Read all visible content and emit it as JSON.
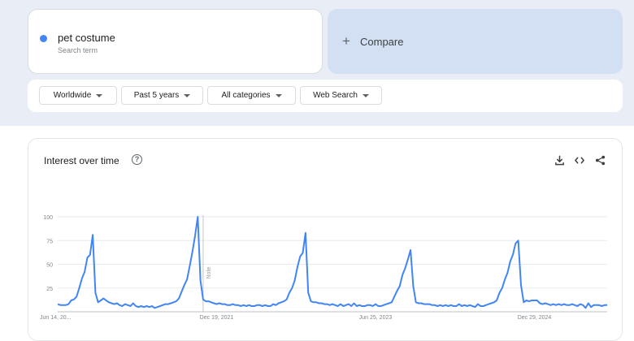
{
  "search_term": {
    "name": "pet costume",
    "subtitle": "Search term",
    "color": "#4285f4"
  },
  "compare": {
    "plus": "+",
    "label": "Compare"
  },
  "filters": [
    {
      "label": "Worldwide"
    },
    {
      "label": "Past 5 years"
    },
    {
      "label": "All categories"
    },
    {
      "label": "Web Search"
    }
  ],
  "chart": {
    "title": "Interest over time",
    "help_glyph": "?",
    "note_label": "Note",
    "icons": [
      "download-icon",
      "embed-code-icon",
      "share-icon"
    ]
  },
  "chart_data": {
    "type": "line",
    "ylim": [
      0,
      100
    ],
    "yticks": [
      25,
      50,
      75,
      100
    ],
    "xtick_labels": [
      "Jun 14, 20...",
      "Dec 19, 2021",
      "Jun 25, 2023",
      "Dec 29, 2024"
    ],
    "grid": true,
    "series": [
      {
        "color": "#4285f4",
        "values": [
          8,
          7,
          7,
          7,
          8,
          12,
          13,
          16,
          25,
          35,
          42,
          57,
          60,
          81,
          20,
          10,
          12,
          14,
          12,
          10,
          9,
          8,
          9,
          7,
          6,
          8,
          7,
          6,
          9,
          6,
          5,
          6,
          5,
          6,
          5,
          6,
          4,
          5,
          6,
          7,
          8,
          8,
          9,
          10,
          11,
          14,
          21,
          28,
          34,
          48,
          63,
          80,
          100,
          33,
          13,
          11,
          11,
          10,
          9,
          8,
          9,
          8,
          8,
          7,
          7,
          8,
          7,
          7,
          6,
          7,
          6,
          7,
          6,
          6,
          7,
          7,
          6,
          7,
          6,
          6,
          8,
          7,
          9,
          10,
          11,
          13,
          20,
          25,
          33,
          47,
          58,
          62,
          83,
          20,
          11,
          10,
          10,
          9,
          9,
          8,
          8,
          7,
          8,
          7,
          6,
          8,
          6,
          7,
          8,
          6,
          9,
          6,
          7,
          6,
          6,
          7,
          7,
          6,
          8,
          6,
          6,
          7,
          8,
          9,
          10,
          16,
          22,
          27,
          39,
          46,
          55,
          65,
          27,
          10,
          9,
          9,
          8,
          8,
          8,
          7,
          7,
          6,
          7,
          6,
          7,
          6,
          7,
          6,
          6,
          8,
          6,
          7,
          6,
          7,
          6,
          5,
          8,
          6,
          6,
          7,
          8,
          9,
          10,
          12,
          20,
          25,
          34,
          41,
          53,
          60,
          72,
          75,
          28,
          10,
          12,
          11,
          12,
          12,
          12,
          9,
          8,
          9,
          8,
          7,
          8,
          7,
          8,
          7,
          8,
          7,
          7,
          8,
          7,
          6,
          8,
          7,
          4,
          9,
          5,
          7,
          7,
          7,
          6,
          7,
          7
        ]
      }
    ]
  }
}
